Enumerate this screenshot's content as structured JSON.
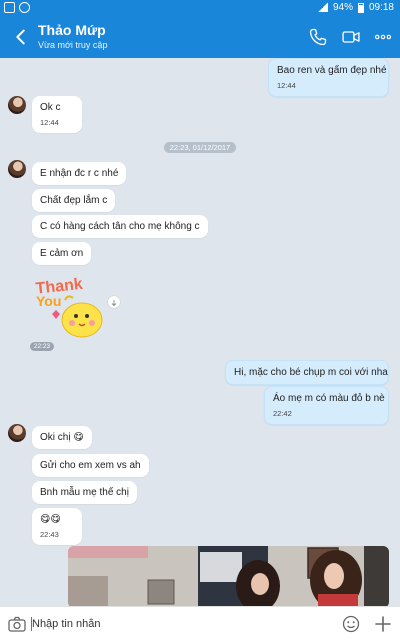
{
  "status_bar": {
    "battery": "94%",
    "time": "09:18"
  },
  "header": {
    "title": "Thảo Mứp",
    "subtitle": "Vừa mới truy cập",
    "icons": [
      "back-arrow-icon",
      "phone-icon",
      "video-call-icon",
      "more-icon"
    ]
  },
  "chat": {
    "divider_date": "22:23, 01/12/2017",
    "sticker_time": "22:23",
    "messages": [
      {
        "from": "me",
        "text": "Bao ren và gấm đẹp nhé",
        "time": "12:44"
      },
      {
        "from": "them",
        "text": "Ok c",
        "time": "12:44"
      },
      {
        "from": "them",
        "text": "E nhận đc r c nhé"
      },
      {
        "from": "them",
        "text": "Chất đẹp lắm c"
      },
      {
        "from": "them",
        "text": "C có hàng cách tân cho mẹ không c"
      },
      {
        "from": "them",
        "text": "E cảm ơn"
      },
      {
        "from": "me",
        "text": "Hi, mặc cho bé chụp m coi với nha"
      },
      {
        "from": "me",
        "text": "Áo mẹ m có màu đỏ b nè",
        "time": "22:42"
      },
      {
        "from": "them",
        "text": "Oki chị 😋"
      },
      {
        "from": "them",
        "text": "Gửi cho em xem vs ah"
      },
      {
        "from": "them",
        "text": "Bnh mẫu mẹ thế chị"
      },
      {
        "from": "them",
        "text": "😋😋",
        "time": "22:43"
      }
    ]
  },
  "input_bar": {
    "placeholder": "Nhập tin nhắn"
  },
  "colors": {
    "brand": "#1a86d9",
    "chat_bg": "#dfe5ec",
    "my_bubble": "#d5ecfd"
  }
}
